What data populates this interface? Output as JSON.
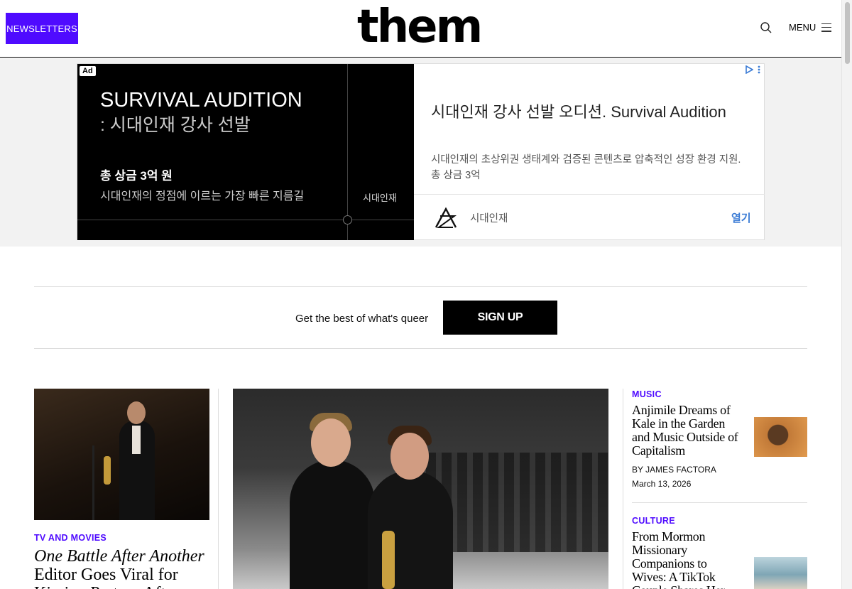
{
  "header": {
    "newsletters_label": "NEWSLETTERS",
    "logo_text": "them",
    "menu_label": "MENU",
    "accent_color": "#4f0bff"
  },
  "ad": {
    "badge": "Ad",
    "image_title": "SURVIVAL AUDITION",
    "image_subtitle": ": 시대인재 강사 선발",
    "image_prize": "총 상금 3억 원",
    "image_tagline": "시대인재의 정점에 이르는 가장 빠른 지름길",
    "image_brand": "시대인재",
    "headline": "시대인재 강사 선발 오디션. Survival Audition",
    "description": "시대인재의 초상위권 생태계와 검증된 콘텐츠로 압축적인 성장 환경 지원. 총 상금 3억",
    "advertiser": "시대인재",
    "cta": "열기",
    "cta_color": "#3a7bd5"
  },
  "signup": {
    "text": "Get the best of what's queer",
    "button_label": "SIGN UP"
  },
  "articles": {
    "left": {
      "category": "TV AND MOVIES",
      "title_italic": "One Battle After Another",
      "title_rest": " Editor Goes Viral for Kissing Partner After"
    },
    "right": [
      {
        "category": "MUSIC",
        "title": "Anjimile Dreams of Kale in the Garden and Music Outside of Capitalism",
        "byline": "BY JAMES FACTORA",
        "date": "March 13, 2026"
      },
      {
        "category": "CULTURE",
        "title": "From Mormon Missionary Companions to Wives: A TikTok Couple Shares Her"
      }
    ]
  }
}
